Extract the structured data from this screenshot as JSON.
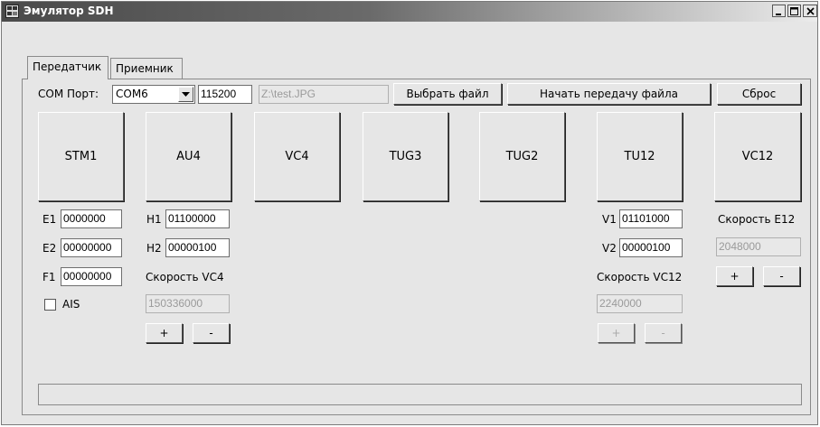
{
  "window": {
    "title": "Эмулятор SDH",
    "controls": {
      "minimize": "_",
      "maximize": "□",
      "close": "X"
    }
  },
  "tabs": [
    {
      "label": "Передатчик",
      "active": true
    },
    {
      "label": "Приемник",
      "active": false
    }
  ],
  "port": {
    "label": "COM Порт:",
    "selected": "COM6",
    "baud": "115200",
    "file_path": "Z:\\test.JPG",
    "choose_file": "Выбрать файл",
    "start_transfer": "Начать передачу файла",
    "reset": "Сброс"
  },
  "blocks": [
    "STM1",
    "AU4",
    "VC4",
    "TUG3",
    "TUG2",
    "TU12",
    "VC12"
  ],
  "stm1": {
    "e1": {
      "label": "E1",
      "value": "0000000"
    },
    "e2": {
      "label": "E2",
      "value": "00000000"
    },
    "f1": {
      "label": "F1",
      "value": "00000000"
    },
    "ais": {
      "label": "AIS",
      "checked": false
    }
  },
  "au4": {
    "h1": {
      "label": "H1",
      "value": "01100000"
    },
    "h2": {
      "label": "H2",
      "value": "00000100"
    },
    "speed_label": "Скорость VC4",
    "speed_value": "150336000",
    "plus": "+",
    "minus": "-"
  },
  "tu12": {
    "v1": {
      "label": "V1",
      "value": "01101000"
    },
    "v2": {
      "label": "V2",
      "value": "00000100"
    },
    "speed_label": "Скорость VC12",
    "speed_value": "2240000",
    "plus": "+",
    "minus": "-"
  },
  "vc12": {
    "speed_label": "Скорость E12",
    "speed_value": "2048000",
    "plus": "+",
    "minus": "-"
  },
  "progress": {
    "value": 0
  }
}
